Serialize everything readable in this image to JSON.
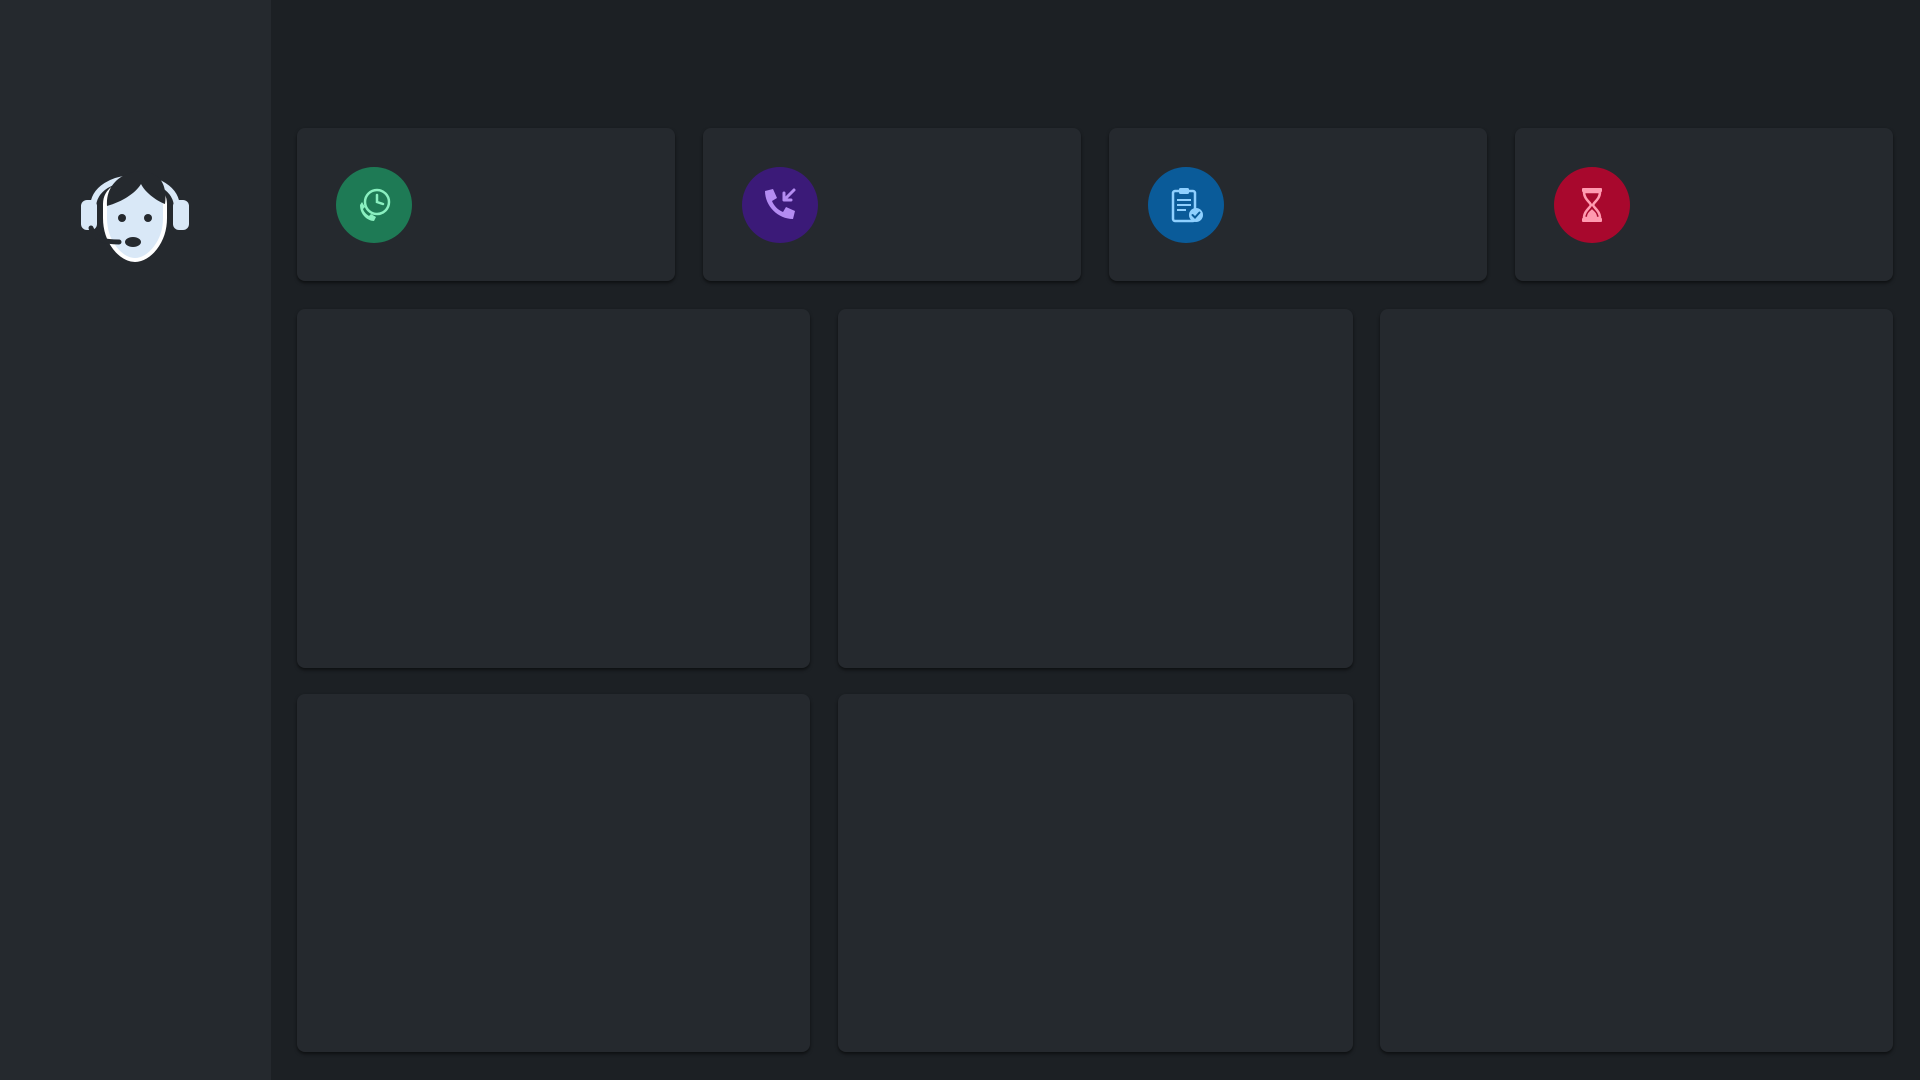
{
  "app": {
    "logo_icon": "headset-agent-icon"
  },
  "stats": [
    {
      "icon": "phone-clock-icon",
      "color": "#1e7a55",
      "label": "",
      "value": ""
    },
    {
      "icon": "incoming-call-icon",
      "color": "#3b1a78",
      "label": "",
      "value": ""
    },
    {
      "icon": "clipboard-check-icon",
      "color": "#0a5b99",
      "label": "",
      "value": ""
    },
    {
      "icon": "hourglass-icon",
      "color": "#a8082d",
      "label": "",
      "value": ""
    }
  ],
  "panels": [
    {
      "title": ""
    },
    {
      "title": ""
    },
    {
      "title": ""
    },
    {
      "title": ""
    },
    {
      "title": ""
    }
  ]
}
